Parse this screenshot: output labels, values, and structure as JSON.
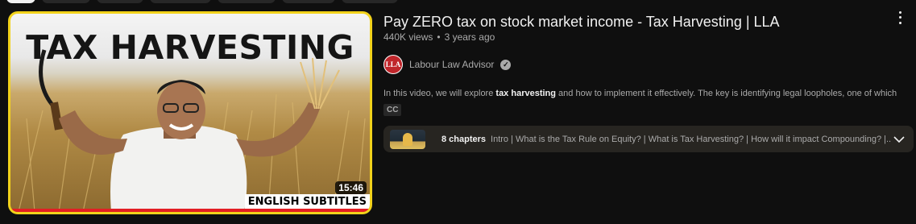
{
  "thumbnail": {
    "title_text": "TAX HARVESTING",
    "subtitle_badge": "ENGLISH SUBTITLES",
    "duration": "15:46",
    "border_color": "#f2d21b",
    "progress_color": "#e31e24"
  },
  "video": {
    "title": "Pay ZERO tax on stock market income - Tax Harvesting | LLA",
    "views": "440K views",
    "age": "3 years ago"
  },
  "channel": {
    "avatar_text": "LLA",
    "name": "Labour Law Advisor",
    "verified_icon": "check-circle-icon"
  },
  "description": {
    "prefix": "In this video, we will explore ",
    "bold": "tax harvesting",
    "suffix": " and how to implement it effectively. The key is identifying legal loopholes, one of which ..."
  },
  "badges": {
    "cc": "CC"
  },
  "chapters": {
    "count_label": "8 chapters",
    "list": "Intro | What is the Tax Rule on Equity? | What is Tax Harvesting? | How will it impact Compounding? |..."
  },
  "icons": {
    "menu": "more-vert-icon",
    "expand": "chevron-down-icon"
  }
}
